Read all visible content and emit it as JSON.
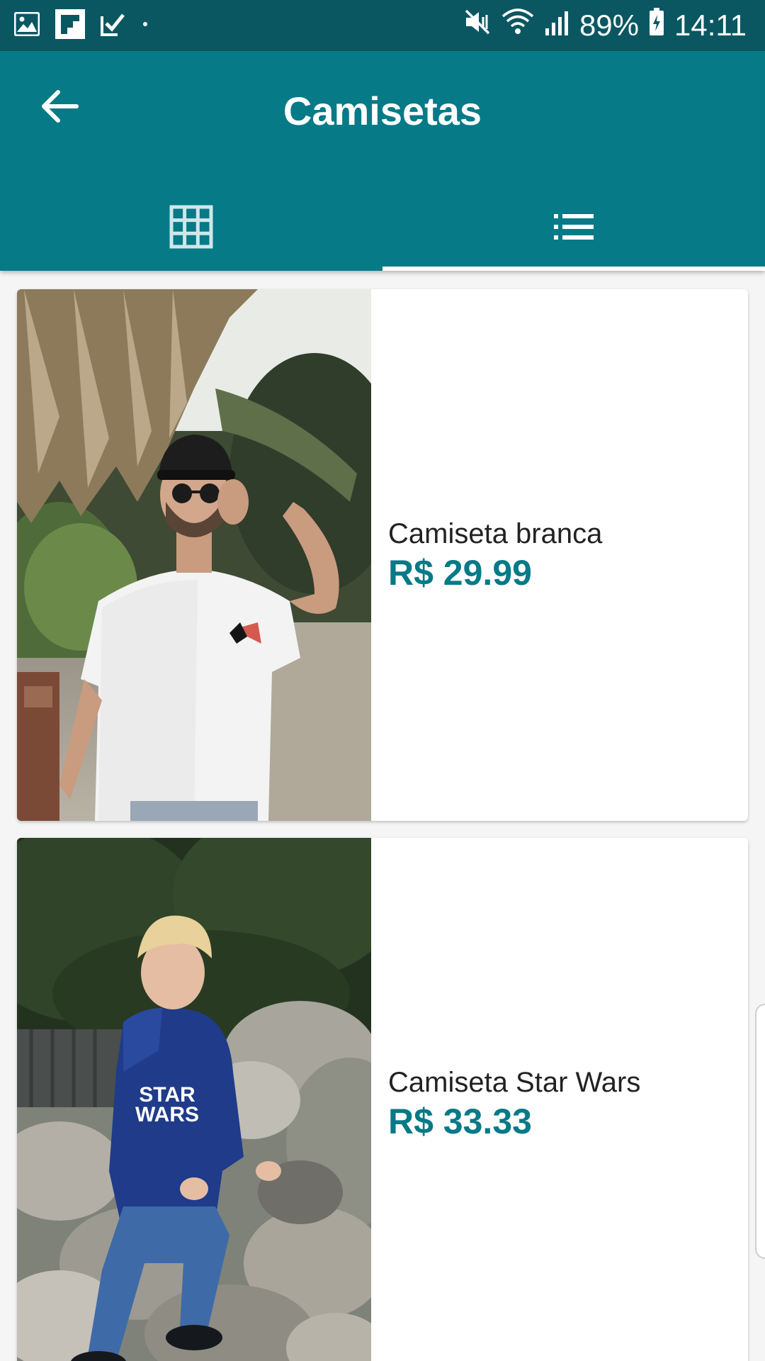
{
  "status_bar": {
    "battery": "89%",
    "time": "14:11",
    "icons": [
      "gallery-icon",
      "flipboard-icon",
      "tasks-icon",
      "dot-icon",
      "mute-icon",
      "wifi-icon",
      "signal-icon",
      "battery-icon"
    ]
  },
  "app_bar": {
    "title": "Camisetas",
    "back_icon": "arrow-left-icon",
    "tabs": [
      {
        "icon": "grid-icon",
        "selected": false
      },
      {
        "icon": "list-icon",
        "selected": true
      }
    ]
  },
  "colors": {
    "status_bar": "#0b5761",
    "primary": "#077a87",
    "price": "#077a87",
    "text": "#222222",
    "background": "#f5f5f5"
  },
  "products": [
    {
      "name": "Camiseta branca",
      "price": "R$ 29.99",
      "image": "man-white-tshirt-photo"
    },
    {
      "name": "Camiseta Star Wars",
      "price": "R$ 33.33",
      "image": "boy-star-wars-hoodie-photo",
      "image_text": "STAR WARS"
    }
  ]
}
